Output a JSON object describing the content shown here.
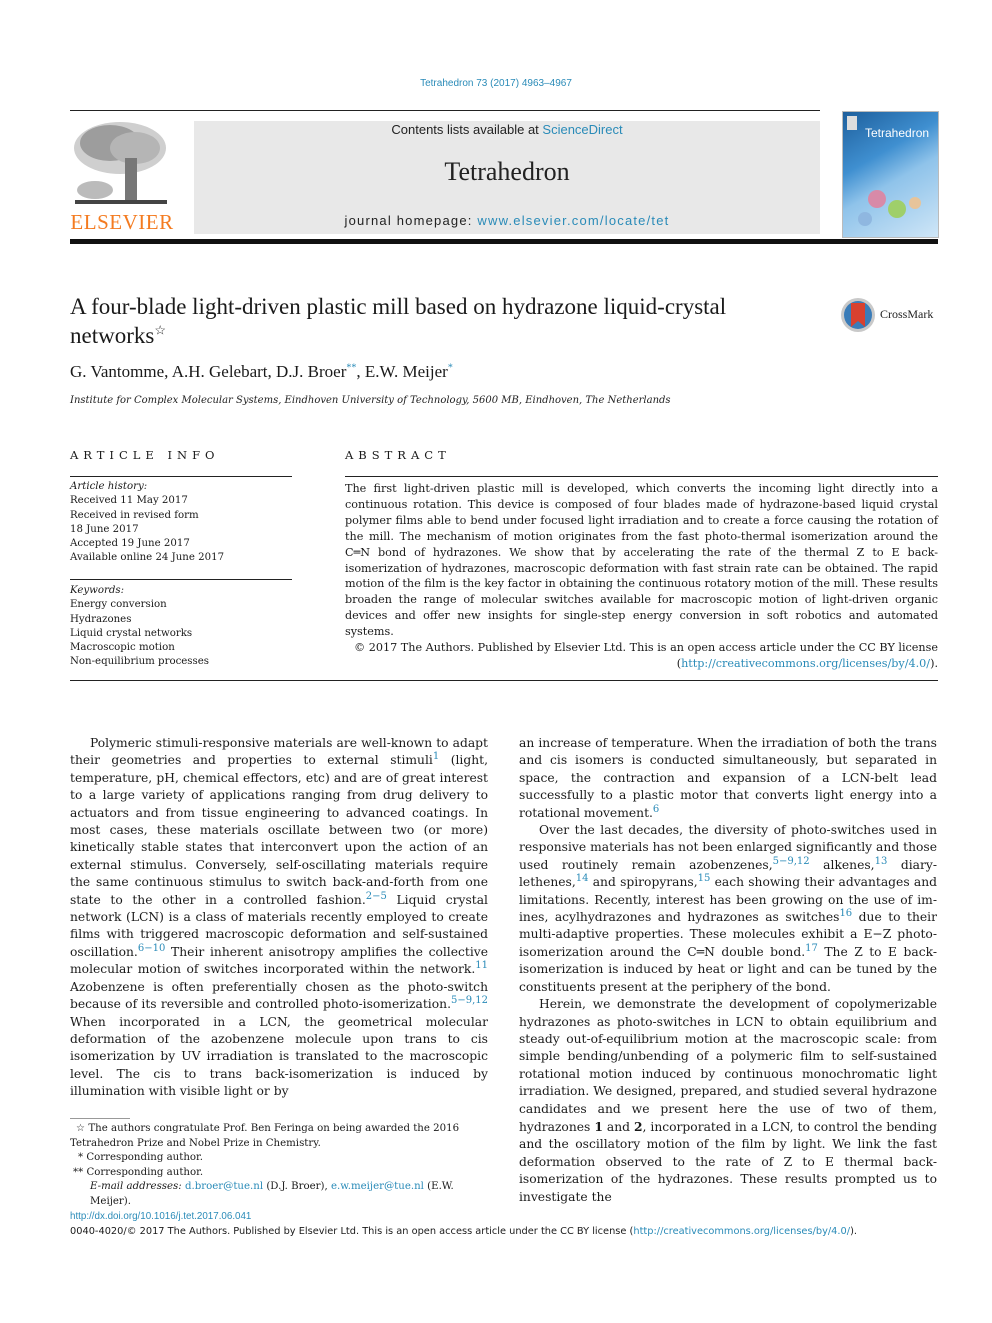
{
  "header": {
    "journal_ref": "Tetrahedron 73 (2017) 4963–4967",
    "contents_prefix": "Contents lists available at ",
    "contents_link": "ScienceDirect",
    "journal_name": "Tetrahedron",
    "homepage_prefix": "journal homepage: ",
    "homepage_link": "www.elsevier.com/locate/tet",
    "publisher_logo": "ELSEVIER",
    "cover_title": "Tetrahedron",
    "crossmark_label": "CrossMark"
  },
  "article": {
    "title": "A four-blade light-driven plastic mill based on hydrazone liquid-crystal networks",
    "title_mark": "☆",
    "authors": [
      {
        "name": "G. Vantomme",
        "mark": ""
      },
      {
        "name": "A.H. Gelebart",
        "mark": ""
      },
      {
        "name": "D.J. Broer",
        "mark": "**"
      },
      {
        "name": "E.W. Meijer",
        "mark": "*"
      }
    ],
    "affiliation": "Institute for Complex Molecular Systems, Eindhoven University of Technology, 5600 MB, Eindhoven, The Netherlands"
  },
  "article_info": {
    "heading": "ARTICLE INFO",
    "history_label": "Article history:",
    "history": [
      "Received 11 May 2017",
      "Received in revised form",
      "18 June 2017",
      "Accepted 19 June 2017",
      "Available online 24 June 2017"
    ],
    "keywords_label": "Keywords:",
    "keywords": [
      "Energy conversion",
      "Hydrazones",
      "Liquid crystal networks",
      "Macroscopic motion",
      "Non-equilibrium processes"
    ]
  },
  "abstract": {
    "heading": "ABSTRACT",
    "text": "The first light-driven plastic mill is developed, which converts the incoming light directly into a continuous rotation. This device is composed of four blades made of hydrazone-based liquid crystal polymer films able to bend under focused light irradiation and to create a force causing the rotation of the mill. The mechanism of motion originates from the fast photo-thermal isomerization around the C═N bond of hydrazones. We show that by accelerating the rate of the thermal Z to E back-isomerization of hydrazones, macroscopic deformation with fast strain rate can be obtained. The rapid motion of the film is the key factor in obtaining the continuous rotatory motion of the mill. These results broaden the range of molecular switches available for macroscopic motion of light-driven organic devices and offer new insights for single-step energy conversion in soft robotics and automated systems.",
    "copyright": "© 2017 The Authors. Published by Elsevier Ltd. This is an open access article under the CC BY license",
    "license_link": "http://creativecommons.org/licenses/by/4.0/"
  },
  "body": {
    "left": {
      "p1_a": "Polymeric stimuli-responsive materials are well-known to adapt their geometries and properties to external stimuli",
      "ref1": "1",
      "p1_b": " (light, temperature, pH, chemical effectors, etc) and are of great interest to a large variety of applications ranging from drug delivery to actu­ators and from tissue engineering to advanced coatings. In most cases, these materials oscillate between two (or more) kinetically stable states that interconvert upon the action of an external stimulus. Conversely, self-oscillating materials require the same continuous stimulus to switch back-and-forth from one state to the other in a controlled fashion.",
      "ref2": "2−5",
      "p1_c": " Liquid crystal network (LCN) is a class of materials recently employed to create films with triggered macroscopic deformation and self-sustained oscillation.",
      "ref3": "6−10",
      "p1_d": " Their inherent anisotropy amplifies the collective molecular motion of switches incorporated within the network.",
      "ref4": "11",
      "p1_e": " Azobenzene is often preferentially chosen as the photo-switch because of its reversible and controlled photo-isomerization.",
      "ref5": "5−9,12",
      "p1_f": " When incorporated in a LCN, the geometrical molecular deformation of the azobenzene molecule upon trans to cis isomerization by UV irradiation is translated to the macroscopic level. The cis to trans back-isomerization is induced by illumination with visible light or by"
    },
    "right": {
      "p1_a": "an increase of temperature. When the irradiation of both the trans and cis isomers is conducted simultaneously, but separated in space, the contraction and expansion of a LCN-belt lead successfully to a plastic motor that converts light energy into a rotational movement.",
      "ref6": "6",
      "p2_a": "Over the last decades, the diversity of photo-switches used in responsive materials has not been enlarged significantly and those used routinely remain azobenzenes,",
      "ref7": "5−9,12",
      "p2_b": " alkenes,",
      "ref8": "13",
      "p2_c": " diary­lethenes,",
      "ref9": "14",
      "p2_d": " and spiropyrans,",
      "ref10": "15",
      "p2_e": " each showing their advantages and limitations. Recently, interest has been growing on the use of im­ines, acylhydrazones and hydrazones as switches",
      "ref11": "16",
      "p2_f": " due to their multi-adaptive properties. These molecules exhibit a E−Z photo-isomerization around the C═N double bond.",
      "ref12": "17",
      "p2_g": " The Z to E back-isomerization is induced by heat or light and can be tuned by the constituents present at the periphery of the bond.",
      "p3_a": "Herein, we demonstrate the development of copolymerizable hydrazones as photo-switches in LCN to obtain equilibrium and steady out-of-equilibrium motion at the macroscopic scale: from simple bending/unbending of a polymeric film to self-sustained rotational motion induced by continuous monochromatic light irradiation. We designed, prepared, and studied several hydrazone candidates and we present here the use of two of them, hydrazones ",
      "bold1": "1",
      "p3_b": " and ",
      "bold2": "2",
      "p3_c": ", incorporated in a LCN, to control the bending and the oscillatory motion of the film by light. We link the fast deformation observed to the rate of Z to E thermal back-isomerization of the hydrazones. These results prompted us to investigate the"
    }
  },
  "footnotes": {
    "star_mark": "☆",
    "star_text": "The authors congratulate Prof. Ben Feringa on being awarded the 2016 Tetra­hedron Prize and Nobel Prize in Chemistry.",
    "corr1_mark": "*",
    "corr1_text": "Corresponding author.",
    "corr2_mark": "**",
    "corr2_text": "Corresponding author.",
    "email_label": "E-mail addresses:",
    "email1": "d.broer@tue.nl",
    "email1_owner": " (D.J. Broer), ",
    "email2": "e.w.meijer@tue.nl",
    "email2_owner": " (E.W. Meijer)."
  },
  "footer": {
    "doi": "http://dx.doi.org/10.1016/j.tet.2017.06.041",
    "issn_text": "0040-4020/© 2017 The Authors. Published by Elsevier Ltd. This is an open access article under the CC BY license (",
    "license_link": "http://creativecommons.org/licenses/by/4.0/",
    "issn_end": ")."
  },
  "colors": {
    "link": "#2a8bb8",
    "elsevier_orange": "#f47b20",
    "masthead_bg": "#e8e8e8"
  }
}
